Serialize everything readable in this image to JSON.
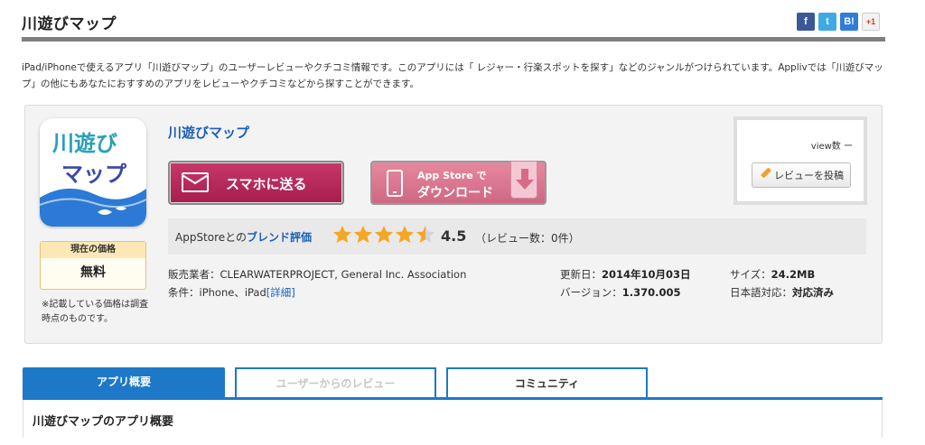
{
  "header": {
    "title": "川遊びマップ",
    "social": {
      "facebook": "f",
      "twitter": "t",
      "hatena": "B!",
      "googleplus": "+1"
    }
  },
  "intro": "iPad/iPhoneで使えるアプリ「川遊びマップ」のユーザーレビューやクチコミ情報です。このアプリには「 レジャー・行楽スポットを探す」などのジャンルがつけられています。Applivでは「川遊びマップ」の他にもあなたにおすすめのアプリをレビューやクチコミなどから探すことができます。",
  "app": {
    "icon_text_1": "川遊び",
    "icon_text_2": "マップ",
    "name": "川遊びマップ",
    "price_label": "現在の価格",
    "price": "無料",
    "price_note": "※記載している価格は調査時点のものです。"
  },
  "buttons": {
    "send_to_phone": "スマホに送る",
    "appstore_line1": "App Store で",
    "appstore_line2": "ダウンロード",
    "post_review": "レビューを投稿"
  },
  "rating": {
    "label_prefix": "AppStoreとの",
    "label_link": "ブレンド評価",
    "value": 4.5,
    "value_text": "4.5",
    "review_count": "（レビュー数：0件）",
    "star_color": "#f5a623"
  },
  "meta": {
    "seller_label": "販売業者：",
    "seller": "CLEARWATERPROJECT, General Inc. Association",
    "condition_label": "条件：",
    "condition": "iPhone、iPad",
    "details_link": "[詳細]",
    "updated_label": "更新日：",
    "updated": "2014年10月03日",
    "version_label": "バージョン：",
    "version": "1.370.005",
    "size_label": "サイズ：",
    "size": "24.2MB",
    "japanese_label": "日本語対応：",
    "japanese": "対応済み"
  },
  "views": {
    "label": "view数",
    "value": "ー"
  },
  "tabs": [
    {
      "label": "アプリ概要"
    },
    {
      "label": "ユーザーからのレビュー"
    },
    {
      "label": "コミュニティ"
    }
  ],
  "overview_heading": "川遊びマップのアプリ概要",
  "colors": {
    "accent_blue": "#1d79c8",
    "link_blue": "#1b5fb8",
    "send_button": "#b62a5b",
    "store_button": "#dd7a93"
  }
}
